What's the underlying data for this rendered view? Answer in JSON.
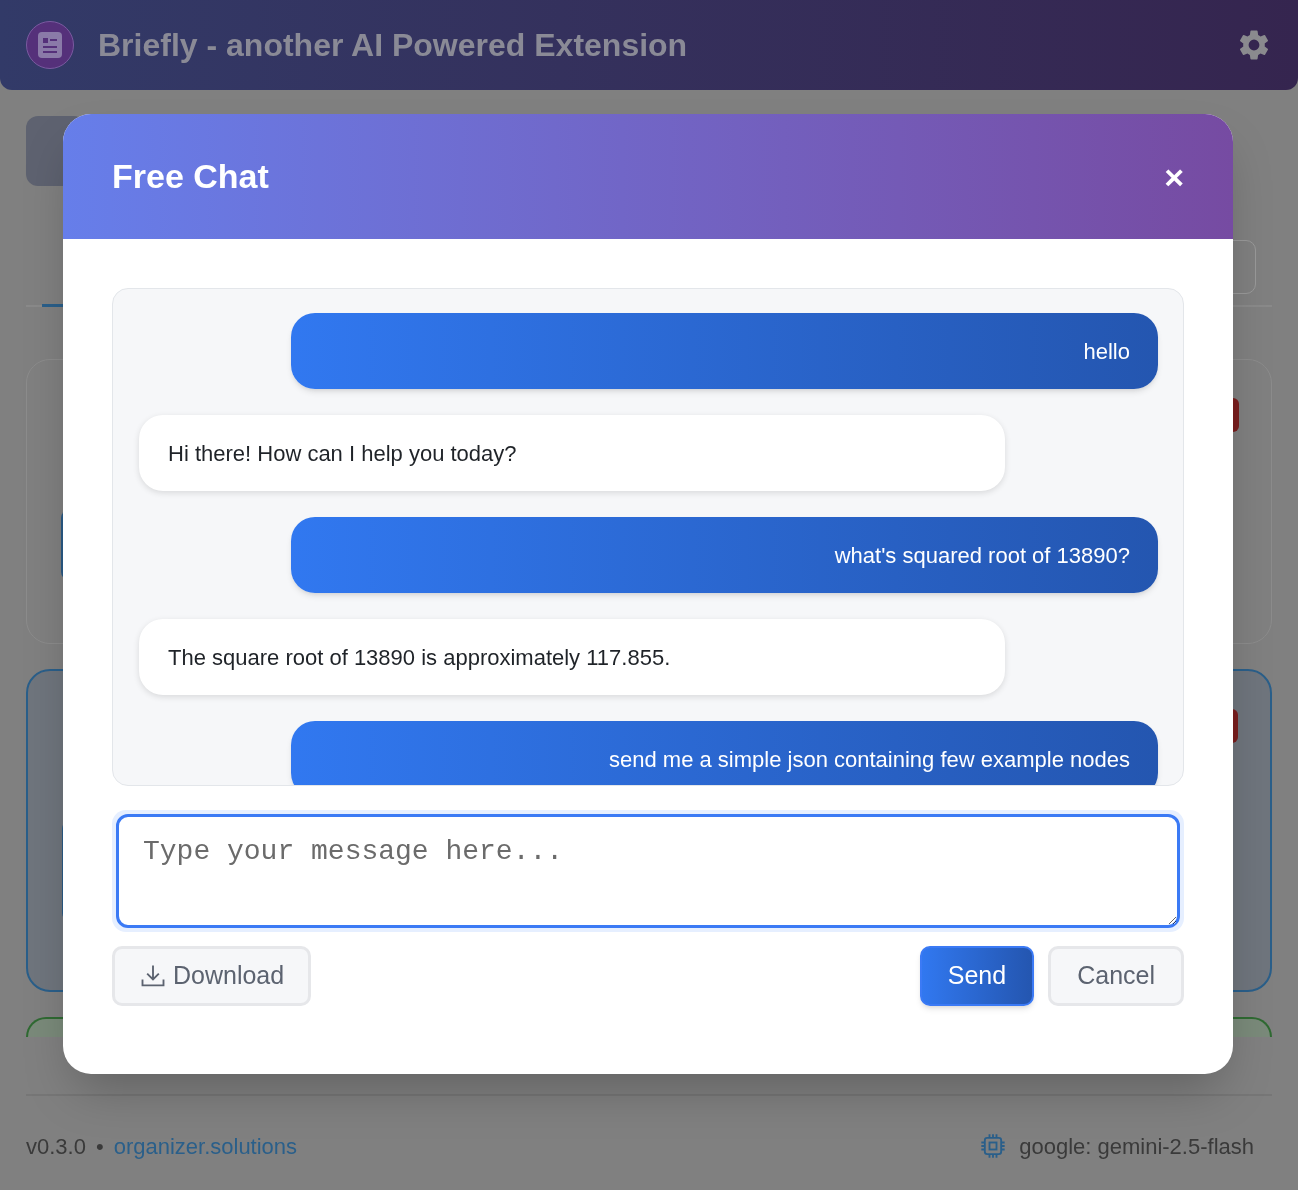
{
  "header": {
    "title": "Briefly - another AI Powered Extension"
  },
  "modal": {
    "title": "Free Chat",
    "close": "×",
    "messages": [
      {
        "kind": "user",
        "text": "hello"
      },
      {
        "kind": "assistant",
        "text": "Hi there! How can I help you today?"
      },
      {
        "kind": "user",
        "text": "what's squared root of 13890?"
      },
      {
        "kind": "assistant",
        "text": "The square root of 13890 is approximately 117.855."
      },
      {
        "kind": "user",
        "text": "send me a simple json containing few example nodes"
      }
    ],
    "input": {
      "placeholder": "Type your message here..."
    },
    "download": {
      "label": "Download"
    },
    "send": {
      "label": "Send"
    },
    "cancel": {
      "label": "Cancel"
    }
  },
  "footer": {
    "version": "v0.3.0",
    "separator": "•",
    "link": "organizer.solutions",
    "model": "google: gemini-2.5-flash"
  }
}
